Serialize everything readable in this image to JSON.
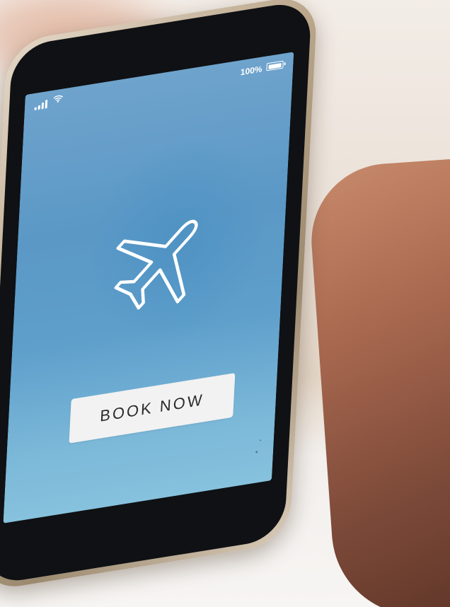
{
  "status_bar": {
    "battery_label": "100%",
    "battery_level": 1.0,
    "signal_icon": "cellular-signal-icon",
    "wifi_icon": "wifi-icon",
    "battery_icon": "battery-icon"
  },
  "main": {
    "hero_icon": "airplane-icon",
    "book_button_label": "BOOK NOW"
  },
  "colors": {
    "screen_blue": "#5b98c6",
    "button_background": "#f2f2f2",
    "button_text": "#2b2b2b",
    "icon_white": "#ffffff"
  }
}
